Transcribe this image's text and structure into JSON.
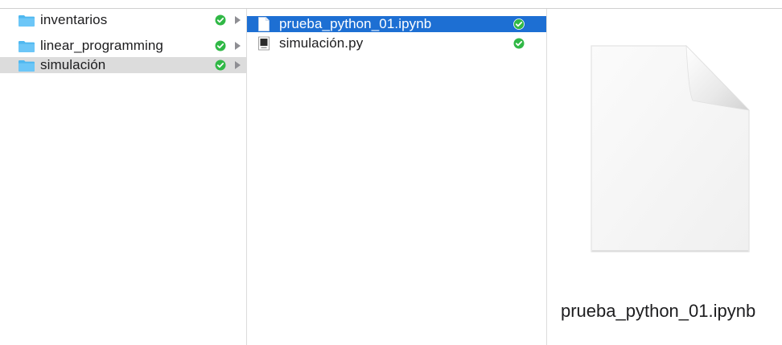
{
  "columns": {
    "folders": [
      {
        "name": "inventarios",
        "icon": "folder-icon",
        "status": "synced"
      },
      {
        "name": "linear_programming",
        "icon": "folder-icon",
        "status": "synced"
      },
      {
        "name": "simulación",
        "icon": "folder-icon",
        "status": "synced",
        "selected": true
      }
    ],
    "files": [
      {
        "name": "prueba_python_01.ipynb",
        "icon": "document-icon",
        "status": "synced",
        "selected": true
      },
      {
        "name": "simulación.py",
        "icon": "python-script-icon",
        "status": "synced"
      }
    ]
  },
  "preview": {
    "filename": "prueba_python_01.ipynb",
    "icon": "generic-document-icon"
  },
  "colors": {
    "selection_active": "#1d6fd3",
    "selection_inactive": "#dcdcdc",
    "folder": "#5ac8fa",
    "sync_check": "#30b846"
  }
}
